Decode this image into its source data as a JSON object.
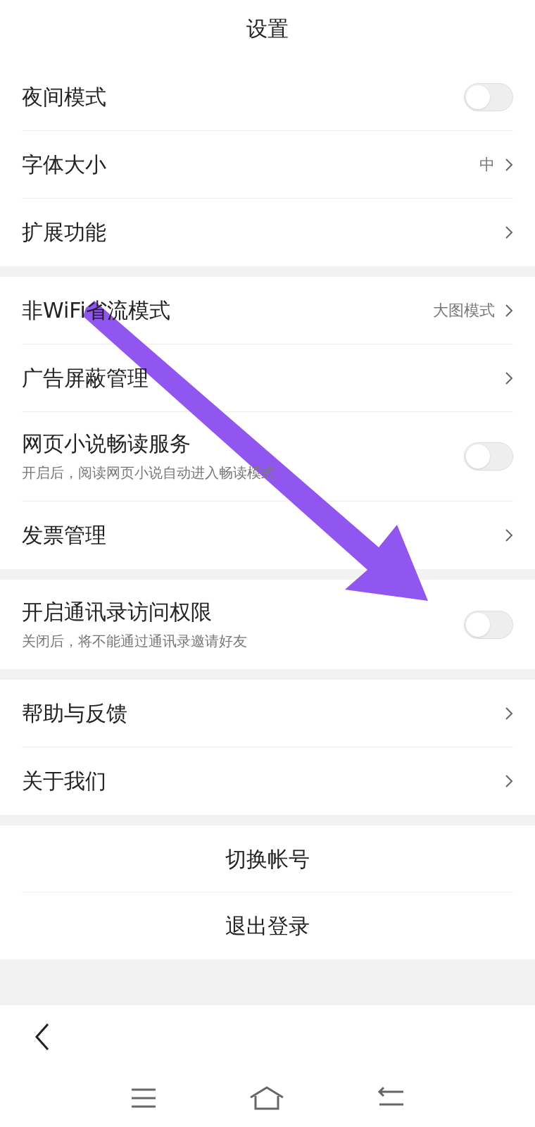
{
  "title": "设置",
  "sections": [
    [
      {
        "kind": "toggle",
        "label": "夜间模式",
        "on": false
      },
      {
        "kind": "link",
        "label": "字体大小",
        "value": "中"
      },
      {
        "kind": "link",
        "label": "扩展功能"
      }
    ],
    [
      {
        "kind": "link",
        "label": "非WiFi省流模式",
        "value": "大图模式"
      },
      {
        "kind": "link",
        "label": "广告屏蔽管理"
      },
      {
        "kind": "toggle",
        "label": "网页小说畅读服务",
        "subtitle": "开启后，阅读网页小说自动进入畅读模式",
        "on": false
      },
      {
        "kind": "link",
        "label": "发票管理"
      }
    ],
    [
      {
        "kind": "toggle",
        "label": "开启通讯录访问权限",
        "subtitle": "关闭后，将不能通过通讯录邀请好友",
        "on": false
      }
    ],
    [
      {
        "kind": "link",
        "label": "帮助与反馈"
      },
      {
        "kind": "link",
        "label": "关于我们"
      }
    ],
    [
      {
        "kind": "action",
        "label": "切换帐号"
      },
      {
        "kind": "action",
        "label": "退出登录"
      }
    ]
  ]
}
